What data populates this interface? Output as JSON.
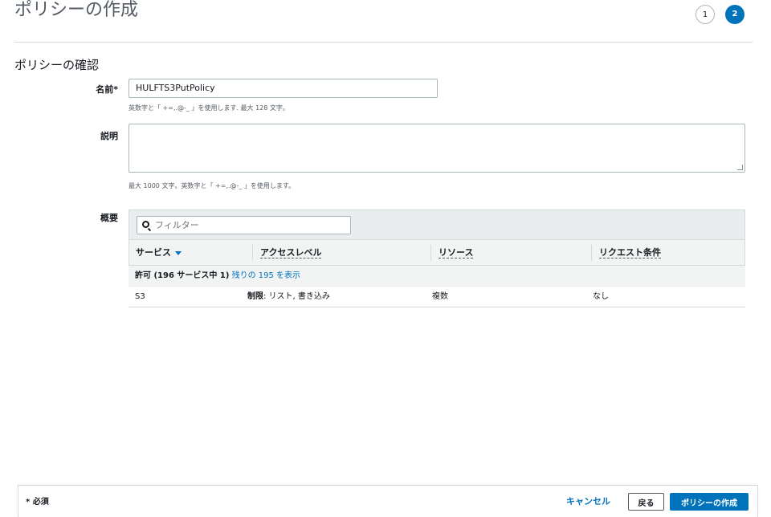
{
  "header": {
    "title": "ポリシーの作成",
    "steps": [
      "1",
      "2"
    ]
  },
  "section": {
    "title": "ポリシーの確認"
  },
  "form": {
    "name_label": "名前*",
    "name_value": "HULFTS3PutPolicy",
    "name_hint": "英数字と「 +=,.@-_ 」を使用します. 最大 128 文字。",
    "description_label": "説明",
    "description_value": "",
    "description_hint": "最大 1000 文字。英数字と「 +=,.@-_ 」を使用します。",
    "summary_label": "概要"
  },
  "summary": {
    "filter_placeholder": "フィルター",
    "columns": [
      "サービス",
      "アクセスレベル",
      "リソース",
      "リクエスト条件"
    ],
    "group": {
      "prefix": "許可 (196 サービス中 1)",
      "link": "残りの 195 を表示"
    },
    "rows": [
      {
        "service": "S3",
        "access_bold": "制限",
        "access_rest": ": リスト, 書き込み",
        "resource": "複数",
        "condition": "なし"
      }
    ]
  },
  "footer": {
    "required": "* 必須",
    "cancel": "キャンセル",
    "back": "戻る",
    "create": "ポリシーの作成"
  },
  "colors": {
    "accent": "#0073bb",
    "border": "#d5dbdb",
    "header_bg": "#f2f3f3"
  }
}
